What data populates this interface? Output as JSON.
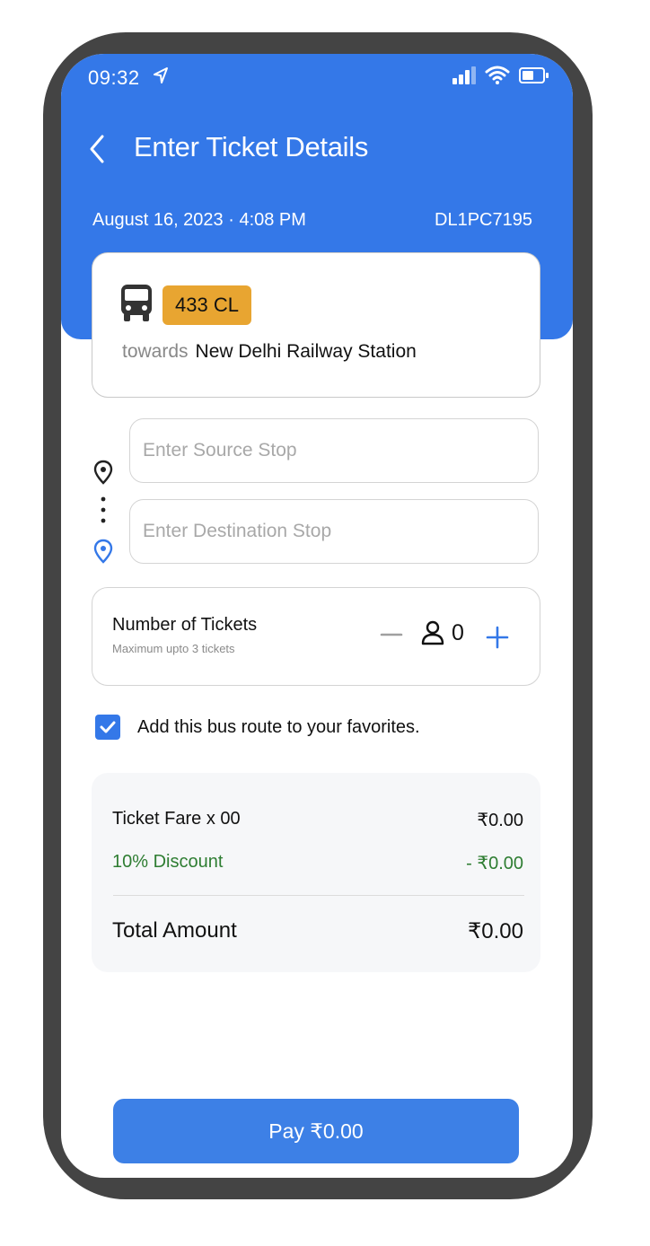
{
  "status_bar": {
    "time": "09:32"
  },
  "header": {
    "title": "Enter Ticket Details",
    "date_time": "August 16, 2023 · 4:08 PM",
    "vehicle_number": "DL1PC7195"
  },
  "route": {
    "number": "433 CL",
    "towards_label": "towards",
    "destination": "New Delhi Railway Station"
  },
  "stops": {
    "source_placeholder": "Enter Source Stop",
    "source_value": "",
    "destination_placeholder": "Enter Destination Stop",
    "destination_value": ""
  },
  "tickets": {
    "title": "Number of Tickets",
    "subtitle": "Maximum upto 3 tickets",
    "count": "0"
  },
  "favorite": {
    "label": "Add this bus route to your favorites.",
    "checked": true
  },
  "fare": {
    "ticket_fare_label": "Ticket Fare x 00",
    "ticket_fare_value": "₹0.00",
    "discount_label": "10% Discount",
    "discount_value": "- ₹0.00",
    "total_label": "Total Amount",
    "total_value": "₹0.00"
  },
  "pay_button": {
    "label": "Pay ₹0.00"
  },
  "colors": {
    "primary": "#3478E8",
    "route_badge": "#E8A531",
    "discount": "#2E7D32",
    "device_frame": "#444444"
  },
  "icons": {
    "status": [
      "location-arrow-icon",
      "cellular-signal-icon",
      "wifi-icon",
      "battery-icon"
    ],
    "header": [
      "back-chevron-icon"
    ],
    "route": [
      "bus-icon"
    ],
    "stops": [
      "map-pin-icon",
      "vertical-dots-icon",
      "map-pin-blue-icon"
    ],
    "tickets": [
      "minus-icon",
      "person-icon",
      "plus-icon"
    ],
    "favorite": [
      "checkmark-icon"
    ]
  }
}
